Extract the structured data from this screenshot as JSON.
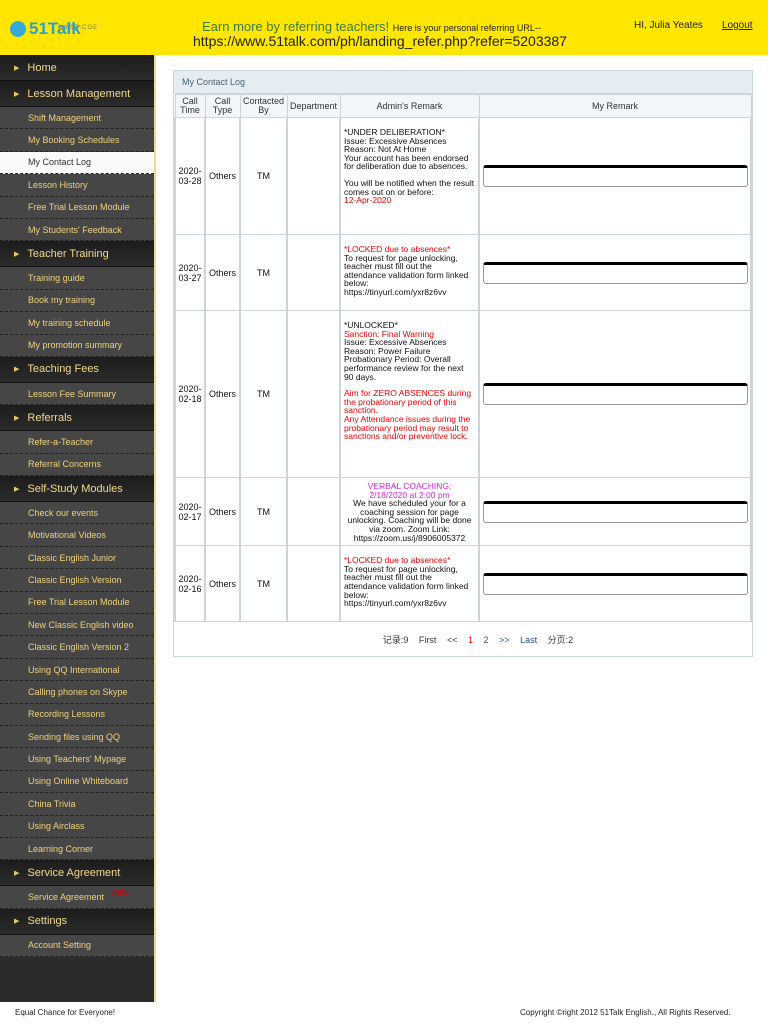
{
  "header": {
    "logo": "51Talk",
    "ticker": "NYSE:COE",
    "promo": "Earn more by referring teachers!",
    "promo_sub": "Here is your personal referring URL--",
    "referral_url": "https://www.51talk.com/ph/landing_refer.php?refer=5203387",
    "greeting": "HI, Julia Yeates",
    "logout": "Logout"
  },
  "sidebar": [
    {
      "type": "header",
      "label": "Home"
    },
    {
      "type": "header",
      "label": "Lesson Management"
    },
    {
      "type": "sub",
      "label": "Shift Management"
    },
    {
      "type": "sub",
      "label": "My Booking Schedules"
    },
    {
      "type": "sub",
      "label": "My Contact Log",
      "active": true
    },
    {
      "type": "sub",
      "label": "Lesson History"
    },
    {
      "type": "sub",
      "label": "Free Trial Lesson Module"
    },
    {
      "type": "sub",
      "label": "My Students' Feedback"
    },
    {
      "type": "header",
      "label": "Teacher Training"
    },
    {
      "type": "sub",
      "label": "Training guide"
    },
    {
      "type": "sub",
      "label": "Book my training"
    },
    {
      "type": "sub",
      "label": "My training schedule"
    },
    {
      "type": "sub",
      "label": "My promotion summary"
    },
    {
      "type": "header",
      "label": "Teaching Fees"
    },
    {
      "type": "sub",
      "label": "Lesson Fee Summary"
    },
    {
      "type": "header",
      "label": "Referrals"
    },
    {
      "type": "sub",
      "label": "Refer-a-Teacher"
    },
    {
      "type": "sub",
      "label": "Referral Concerns"
    },
    {
      "type": "header",
      "label": "Self-Study Modules"
    },
    {
      "type": "sub",
      "label": "Check our events"
    },
    {
      "type": "sub",
      "label": "Motivational Videos"
    },
    {
      "type": "sub",
      "label": "Classic English Junior"
    },
    {
      "type": "sub",
      "label": "Classic English Version"
    },
    {
      "type": "sub",
      "label": "Free Trial Lesson Module"
    },
    {
      "type": "sub",
      "label": "New Classic English video"
    },
    {
      "type": "sub",
      "label": "Classic English Version 2"
    },
    {
      "type": "sub",
      "label": "Using QQ International"
    },
    {
      "type": "sub",
      "label": "Calling phones on Skype"
    },
    {
      "type": "sub",
      "label": "Recording Lessons"
    },
    {
      "type": "sub",
      "label": "Sending files using QQ"
    },
    {
      "type": "sub",
      "label": "Using Teachers' Mypage"
    },
    {
      "type": "sub",
      "label": "Using Online Whiteboard"
    },
    {
      "type": "sub",
      "label": "China Trivia"
    },
    {
      "type": "sub",
      "label": "Using Airclass"
    },
    {
      "type": "sub",
      "label": "Learning Corner"
    },
    {
      "type": "header",
      "label": "Service Agreement"
    },
    {
      "type": "sub",
      "label": "Service Agreement",
      "badge": "new"
    },
    {
      "type": "header",
      "label": "Settings"
    },
    {
      "type": "sub",
      "label": "Account Setting"
    }
  ],
  "log": {
    "title": "My Contact Log",
    "columns": [
      "Call Time",
      "Call Type",
      "Contacted By",
      "Department",
      "Admin's Remark",
      "My Remark"
    ],
    "rows": [
      {
        "time": "2020-03-28",
        "type": "Others",
        "by": "TM",
        "dept": "",
        "remark": [
          [
            "",
            "*UNDER DELIBERATION*"
          ],
          [
            "",
            "Issue: Excessive Absences"
          ],
          [
            "",
            "Reason: Not At Home"
          ],
          [
            "",
            "Your account has been endorsed for deliberation due to absences."
          ],
          [
            "gap",
            ""
          ],
          [
            "",
            "You will be notified when the result comes out on or before:"
          ],
          [
            "red",
            "12-Apr-2020"
          ]
        ]
      },
      {
        "time": "2020-03-27",
        "type": "Others",
        "by": "TM",
        "dept": "",
        "remark": [
          [
            "red",
            "*LOCKED due to absences*"
          ],
          [
            "",
            "To request for page unlocking, teacher must fill out the attendance validation form linked below:"
          ],
          [
            "",
            "https://tinyurl.com/yxr8z6vv"
          ]
        ]
      },
      {
        "time": "2020-02-18",
        "type": "Others",
        "by": "TM",
        "dept": "",
        "remark": [
          [
            "",
            "*UNLOCKED*"
          ],
          [
            "red",
            "Sanction: Final Warning"
          ],
          [
            "",
            "Issue: Excessive Absences"
          ],
          [
            "",
            "Reason: Power Failure"
          ],
          [
            "",
            "Probationary Period: Overall performance review for the next 90 days."
          ],
          [
            "gap",
            ""
          ],
          [
            "red",
            "Aim for ZERO ABSENCES during the probationary period of this sanction."
          ],
          [
            "red",
            "Any Attendance issues during the probationary period may result to sanctions and/or preventive lock."
          ]
        ]
      },
      {
        "time": "2020-02-17",
        "type": "Others",
        "by": "TM",
        "dept": "",
        "center": true,
        "remark": [
          [
            "mag",
            "VERBAL COACHING:"
          ],
          [
            "mag",
            "2/18/2020 at 2:00 pm"
          ],
          [
            "",
            "We have scheduled your for a coaching session for page unlocking. Coaching will be done via zoom. Zoom Link: https://zoom.us/j/8906005372"
          ]
        ]
      },
      {
        "time": "2020-02-16",
        "type": "Others",
        "by": "TM",
        "dept": "",
        "remark": [
          [
            "red",
            "*LOCKED due to absences*"
          ],
          [
            "",
            "To request for page unlocking, teacher must fill out the attendance validation form linked below:"
          ],
          [
            "",
            "https://tinyurl.com/yxr8z6vv"
          ]
        ]
      }
    ]
  },
  "pager": {
    "records": "记录:9",
    "first": "First",
    "prev": "<<",
    "pages": [
      "1",
      "2"
    ],
    "next": ">>",
    "last": "Last",
    "total": "分页:2"
  },
  "footer": {
    "slogan": "Equal Chance for Everyone!",
    "copyright": "Copyright ©right 2012 51Talk English., All Rights Reserved."
  }
}
